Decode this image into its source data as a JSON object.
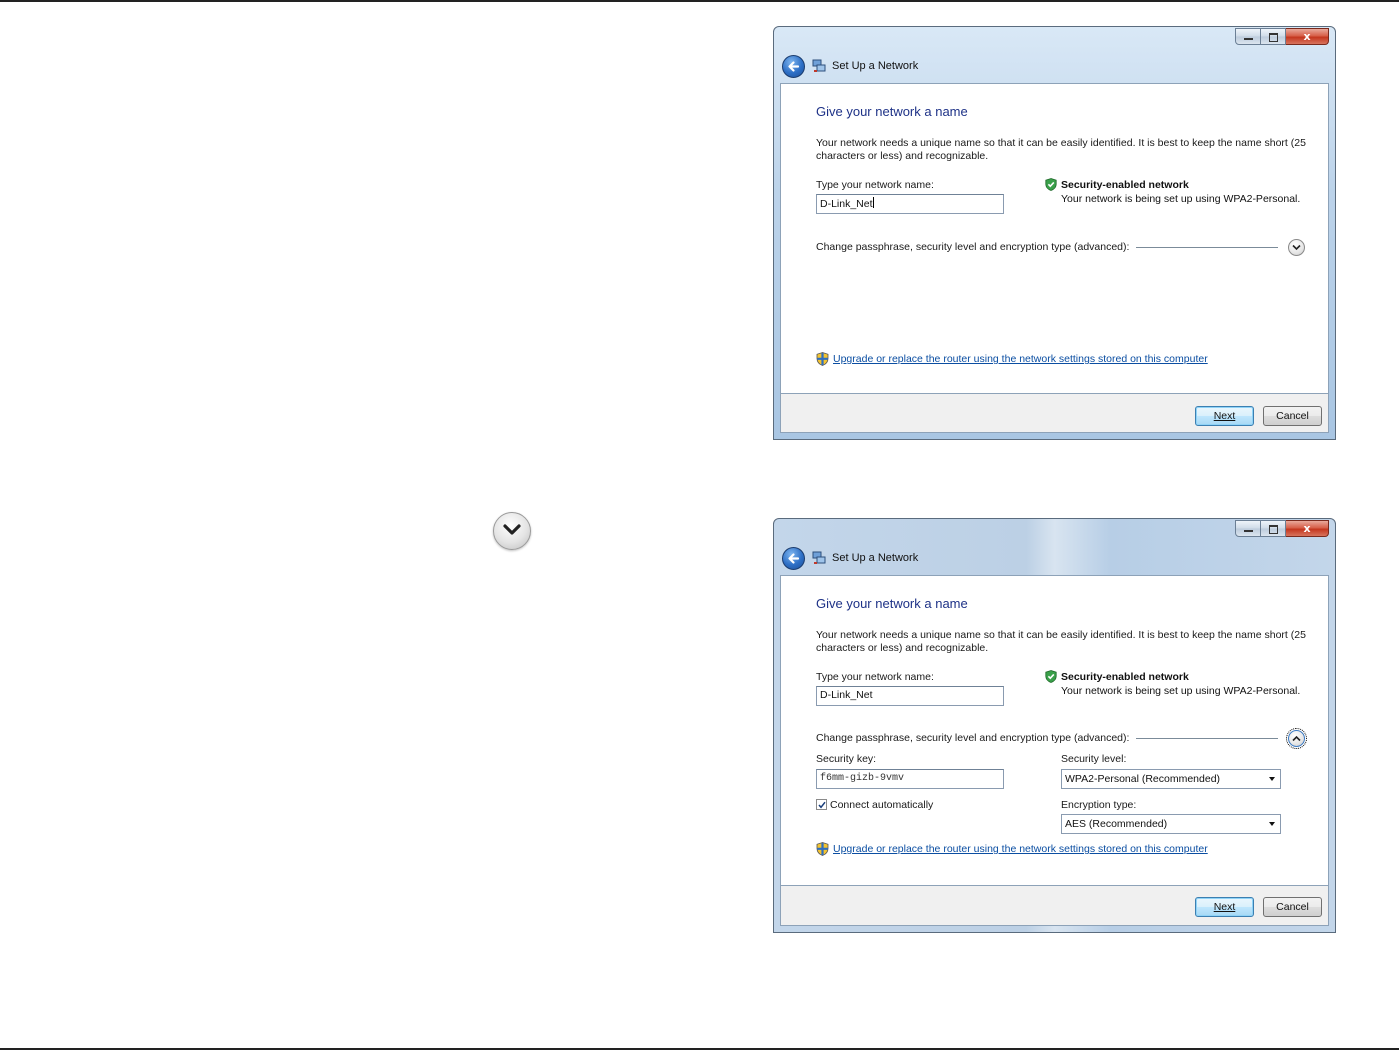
{
  "window_title": "Set Up a Network",
  "close_glyph": "x",
  "windows": [
    {
      "heading": "Give your network a name",
      "description": "Your network needs a unique name so that it can be easily identified. It is best to keep the name short (25 characters or less) and recognizable.",
      "name_label": "Type your network name:",
      "name_value": "D-Link_Net",
      "security_title": "Security-enabled network",
      "security_desc": "Your network is being set up using WPA2-Personal.",
      "advanced_label": "Change passphrase, security level and encryption type (advanced):",
      "router_link": "Upgrade or replace the router using the network settings stored on this computer",
      "next_label": "Next",
      "cancel_label": "Cancel"
    },
    {
      "heading": "Give your network a name",
      "description": "Your network needs a unique name so that it can be easily identified. It is best to keep the name short (25 characters or less) and recognizable.",
      "name_label": "Type your network name:",
      "name_value": "D-Link_Net",
      "security_title": "Security-enabled network",
      "security_desc": "Your network is being set up using WPA2-Personal.",
      "advanced_label": "Change passphrase, security level and encryption type (advanced):",
      "security_key_label": "Security key:",
      "security_key_value": "f6mm-gizb-9vmv",
      "connect_auto_label": "Connect automatically",
      "connect_auto_checked": true,
      "security_level_label": "Security level:",
      "security_level_value": "WPA2-Personal (Recommended)",
      "encryption_label": "Encryption type:",
      "encryption_value": "AES (Recommended)",
      "router_link": "Upgrade or replace the router using the network settings stored on this computer",
      "next_label": "Next",
      "cancel_label": "Cancel"
    }
  ],
  "icons": {
    "side_icon": "chevron-down-circle-icon",
    "back": "back-arrow-icon",
    "network": "network-setup-icon",
    "shield_ok": "security-shield-icon",
    "uac": "uac-shield-icon"
  },
  "colors": {
    "heading": "#1e3287",
    "link": "#0b4ea2",
    "close_button": "#c4371f"
  }
}
